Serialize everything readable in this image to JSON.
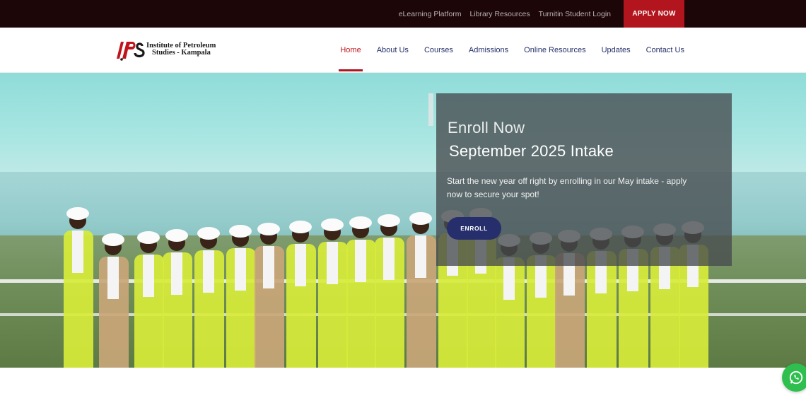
{
  "topbar": {
    "links": [
      "eLearning Platform",
      "Library Resources",
      "Turnitin Student Login"
    ],
    "social_icons": [
      "facebook-icon",
      "linkedin-icon",
      "twitter-icon",
      "youtube-icon"
    ],
    "apply_label": "APPLY NOW",
    "apply_color": "#b2151d"
  },
  "header": {
    "logo": {
      "line1": "Institute of Petroleum",
      "line2": "Studies - Kampala"
    },
    "nav": [
      "Home",
      "About Us",
      "Courses",
      "Admissions",
      "Online Resources",
      "Updates",
      "Contact Us"
    ],
    "active_nav": "Home"
  },
  "hero": {
    "eyebrow": "Enroll Now",
    "title": "September 2025 Intake",
    "description": "Start the new year off right by enrolling in our May intake - apply now to secure your spot!",
    "button_label": "ENROLL",
    "button_color": "#262e6b"
  },
  "floating": {
    "icon": "whatsapp-icon",
    "color": "#2fbf4f"
  }
}
